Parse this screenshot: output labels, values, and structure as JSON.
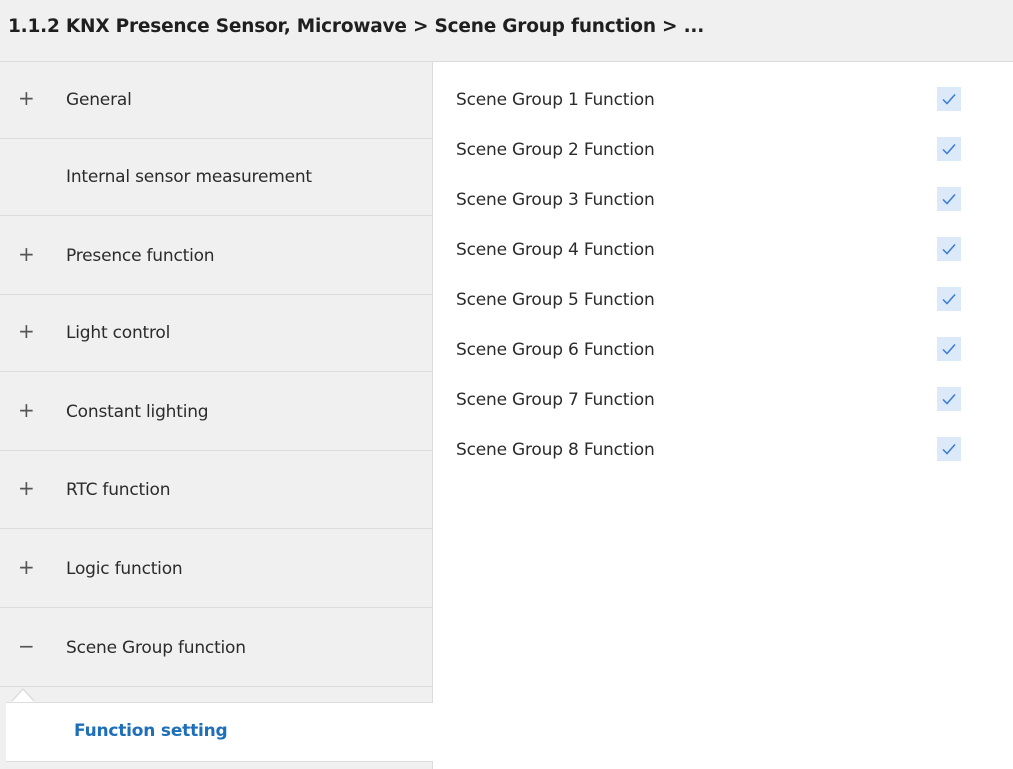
{
  "header": {
    "title": "1.1.2 KNX Presence Sensor, Microwave > Scene Group function > ..."
  },
  "sidebar": {
    "items": [
      {
        "label": "General",
        "toggle": "+"
      },
      {
        "label": "Internal sensor measurement",
        "toggle": ""
      },
      {
        "label": "Presence function",
        "toggle": "+"
      },
      {
        "label": "Light control",
        "toggle": "+"
      },
      {
        "label": "Constant lighting",
        "toggle": "+"
      },
      {
        "label": "RTC function",
        "toggle": "+"
      },
      {
        "label": "Logic function",
        "toggle": "+"
      },
      {
        "label": "Scene Group function",
        "toggle": "−"
      }
    ],
    "sub_item": {
      "label": "Function setting"
    }
  },
  "params": [
    {
      "label": "Scene Group 1 Function",
      "checked": true
    },
    {
      "label": "Scene Group 2 Function",
      "checked": true
    },
    {
      "label": "Scene Group 3 Function",
      "checked": true
    },
    {
      "label": "Scene Group 4 Function",
      "checked": true
    },
    {
      "label": "Scene Group 5 Function",
      "checked": true
    },
    {
      "label": "Scene Group 6 Function",
      "checked": true
    },
    {
      "label": "Scene Group 7 Function",
      "checked": true
    },
    {
      "label": "Scene Group 8 Function",
      "checked": true
    }
  ],
  "colors": {
    "accent": "#1e6fb8",
    "checkbox_bg": "#dbe9f9",
    "checkmark": "#3a7bd5",
    "sidebar_bg": "#f0f0f0"
  }
}
